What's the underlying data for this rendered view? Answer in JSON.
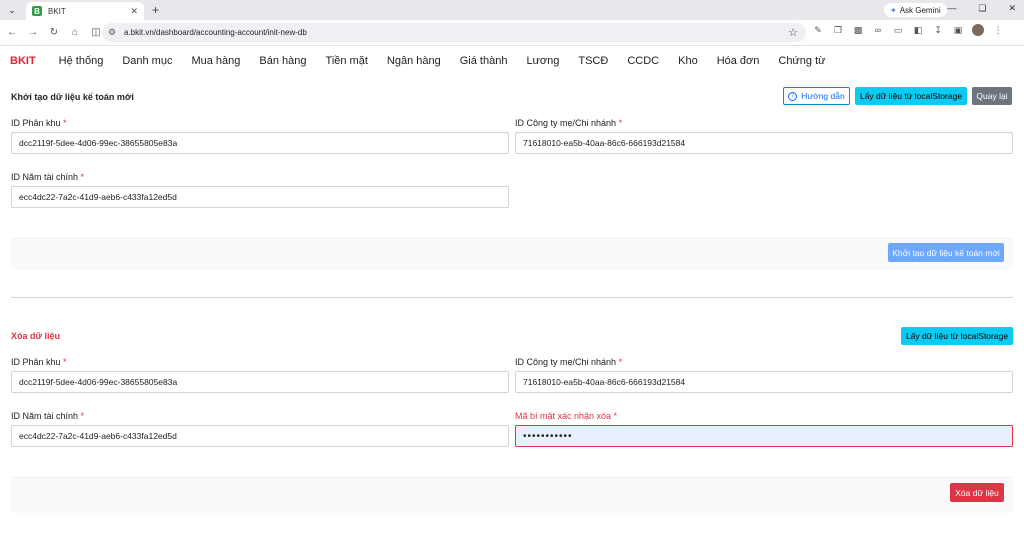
{
  "browser": {
    "tab_title": "BKIT",
    "tab_favicon_letter": "B",
    "url": "a.bkit.vn/dashboard/accounting-account/init-new-db",
    "ask_gemini": "Ask Gemini"
  },
  "app": {
    "brand": "BKIT",
    "menu": [
      "Hệ thống",
      "Danh mục",
      "Mua hàng",
      "Bán hàng",
      "Tiền mặt",
      "Ngân hàng",
      "Giá thành",
      "Lương",
      "TSCĐ",
      "CCDC",
      "Kho",
      "Hóa đơn",
      "Chứng từ"
    ]
  },
  "init_section": {
    "title": "Khởi tạo dữ liệu kế toán mới",
    "help_button": "Hướng dẫn",
    "load_button": "Lấy dữ liệu từ localStorage",
    "back_button": "Quay lại",
    "area_label": "ID Phân khu",
    "area_value": "dcc2119f-5dee-4d06-99ec-38655805e83a",
    "company_label": "ID Công ty mẹ/Chi nhánh",
    "company_value": "71618010-ea5b-40aa-86c6-666193d21584",
    "year_label": "ID Năm tài chính",
    "year_value": "ecc4dc22-7a2c-41d9-aeb6-c433fa12ed5d",
    "submit_button": "Khởi tạo dữ liệu kế toán mới"
  },
  "delete_section": {
    "title": "Xóa dữ liệu",
    "load_button": "Lấy dữ liệu từ localStorage",
    "area_label": "ID Phân khu",
    "area_value": "dcc2119f-5dee-4d06-99ec-38655805e83a",
    "company_label": "ID Công ty mẹ/Chi nhánh",
    "company_value": "71618010-ea5b-40aa-86c6-666193d21584",
    "year_label": "ID Năm tài chính",
    "year_value": "ecc4dc22-7a2c-41d9-aeb6-c433fa12ed5d",
    "secret_label": "Mã bí mật xác nhận xóa",
    "secret_value": "•••••••••••",
    "submit_button": "Xóa dữ liệu"
  },
  "required_mark": "*",
  "colors": {
    "brand": "#e8222d",
    "info": "#0dcaf0",
    "danger": "#dc3545",
    "secondary": "#6c757d",
    "primary_light": "#6ea8fe"
  }
}
